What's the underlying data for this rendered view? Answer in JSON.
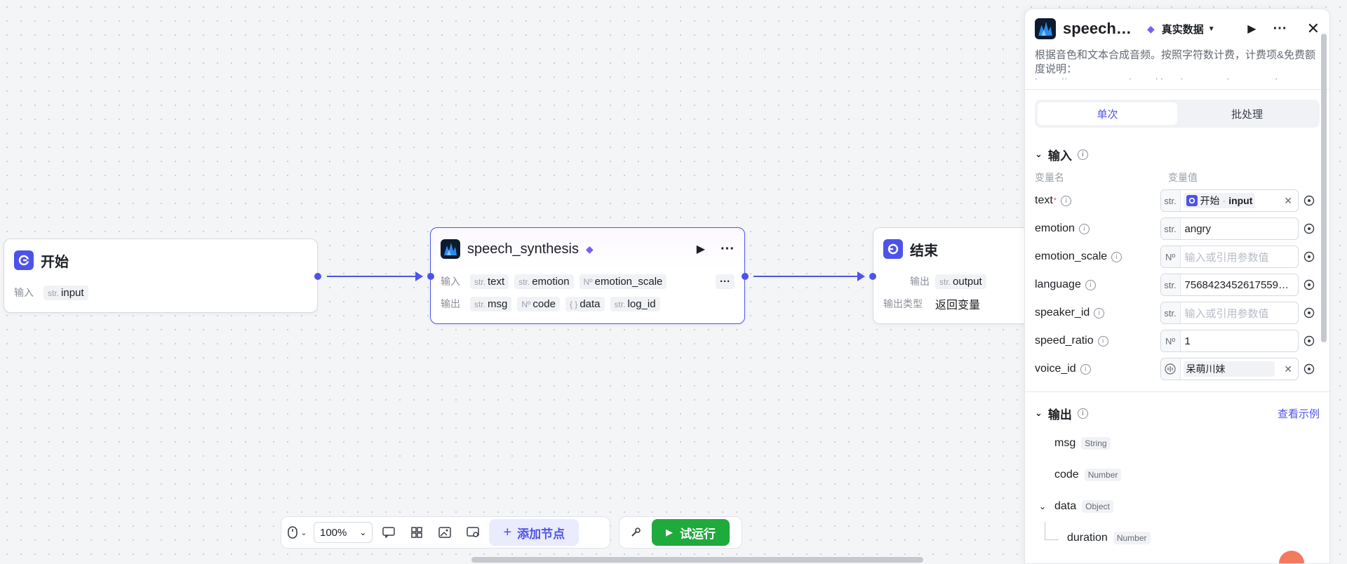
{
  "canvas": {
    "start_node": {
      "title": "开始",
      "input_label": "输入",
      "param": {
        "type": "str.",
        "name": "input"
      }
    },
    "speech_node": {
      "title": "speech_synthesis",
      "input_label": "输入",
      "inputs": [
        {
          "type": "str.",
          "name": "text"
        },
        {
          "type": "str.",
          "name": "emotion"
        },
        {
          "type": "Nº",
          "name": "emotion_scale"
        }
      ],
      "output_label": "输出",
      "outputs": [
        {
          "type": "str.",
          "name": "msg"
        },
        {
          "type": "Nº",
          "name": "code"
        },
        {
          "type": "{ }",
          "name": "data"
        },
        {
          "type": "str.",
          "name": "log_id"
        }
      ]
    },
    "end_node": {
      "title": "结束",
      "output_label": "输出",
      "output_param": {
        "type": "str.",
        "name": "output"
      },
      "output_type_label": "输出类型",
      "output_type_value": "返回变量"
    }
  },
  "toolbar": {
    "zoom": "100%",
    "add_node": "添加节点",
    "run": "试运行"
  },
  "panel": {
    "title": "speech_synthesis",
    "data_source": "真实数据",
    "description": "根据音色和文本合成音频。按照字符数计费，计费项&免费额度说明：https://www.coze.cn/open/docs/coze_pro/asr_tts_price",
    "tabs": {
      "single": "单次",
      "batch": "批处理"
    },
    "input_section": {
      "title": "输入",
      "col_name": "变量名",
      "col_value": "变量值",
      "params": [
        {
          "name": "text",
          "required": "*",
          "type": "str.",
          "ref_node": "开始",
          "ref_sep": " · ",
          "ref_var": "input"
        },
        {
          "name": "emotion",
          "type": "str.",
          "value": "angry"
        },
        {
          "name": "emotion_scale",
          "type": "Nº",
          "placeholder": "输入或引用参数值"
        },
        {
          "name": "language",
          "type": "str.",
          "value": "7568423452617559…"
        },
        {
          "name": "speaker_id",
          "type": "str.",
          "placeholder": "输入或引用参数值"
        },
        {
          "name": "speed_ratio",
          "type": "Nº",
          "value": "1"
        },
        {
          "name": "voice_id",
          "value": "呆萌川妹"
        }
      ]
    },
    "output_section": {
      "title": "输出",
      "example_link": "查看示例",
      "items": [
        {
          "name": "msg",
          "type": "String"
        },
        {
          "name": "code",
          "type": "Number"
        },
        {
          "name": "data",
          "type": "Object"
        },
        {
          "name": "duration",
          "type": "Number"
        }
      ]
    }
  },
  "colors": {
    "accent": "#4d53e8",
    "run_green": "#1faa3c"
  }
}
